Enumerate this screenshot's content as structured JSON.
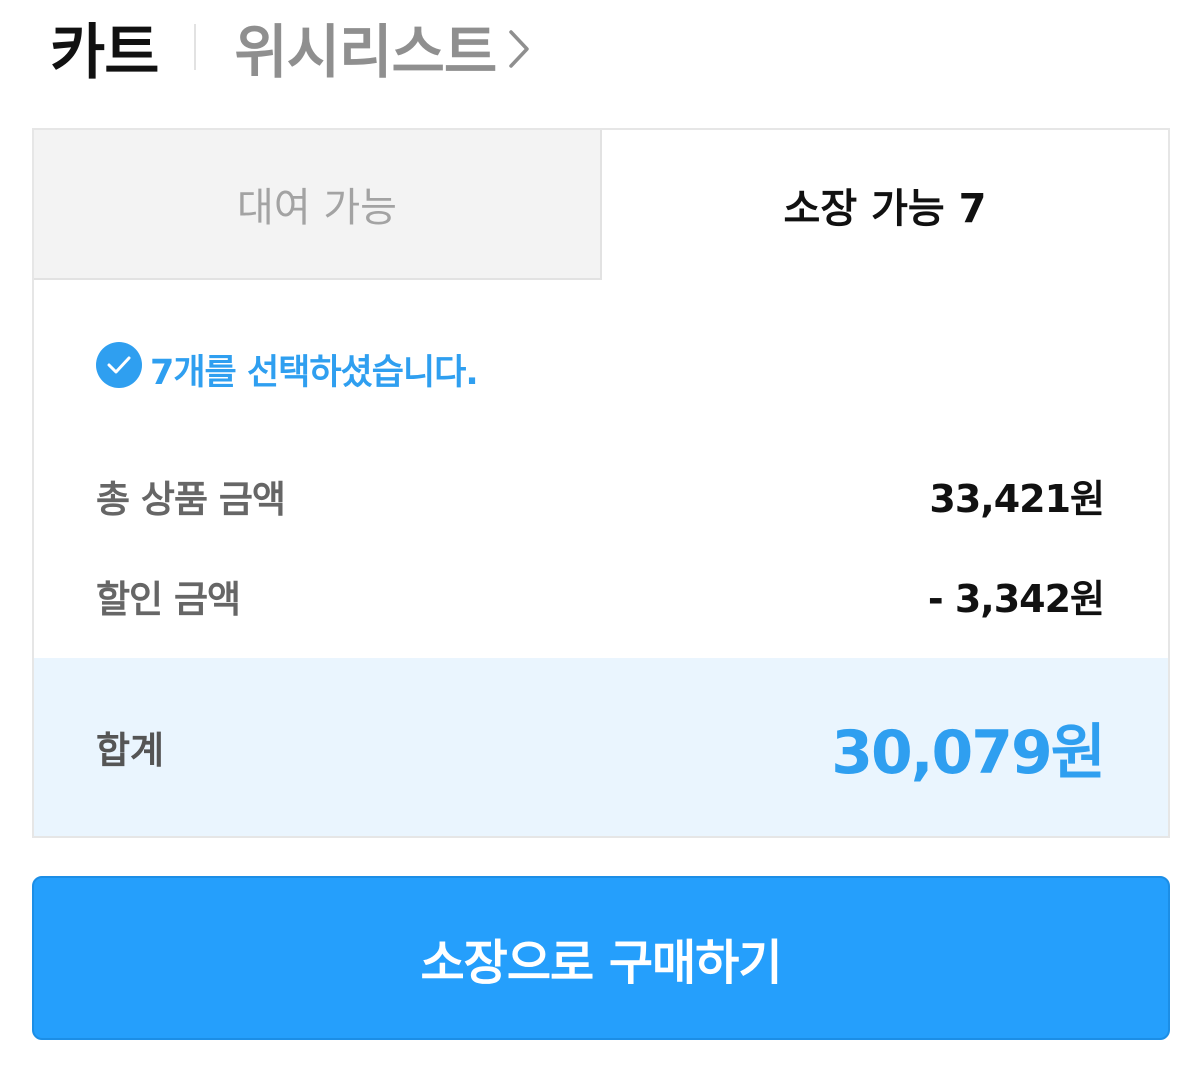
{
  "header": {
    "title": "카트",
    "wishlist_label": "위시리스트"
  },
  "tabs": [
    {
      "label": "대여 가능",
      "active": false
    },
    {
      "label": "소장 가능 7",
      "active": true
    }
  ],
  "summary": {
    "selected_text": "7개를 선택하셨습니다.",
    "total_products_label": "총 상품 금액",
    "total_products_value": "33,421원",
    "discount_label": "할인 금액",
    "discount_value": "- 3,342원",
    "sum_label": "합계",
    "sum_value": "30,079원"
  },
  "buy_button_label": "소장으로 구매하기",
  "colors": {
    "accent": "#2f9ff0",
    "button": "#259ffc",
    "total_bg": "#eaf5fe",
    "tab_inactive_bg": "#f3f3f3"
  },
  "icons": [
    "chevron-right-icon",
    "check-circle-icon"
  ]
}
